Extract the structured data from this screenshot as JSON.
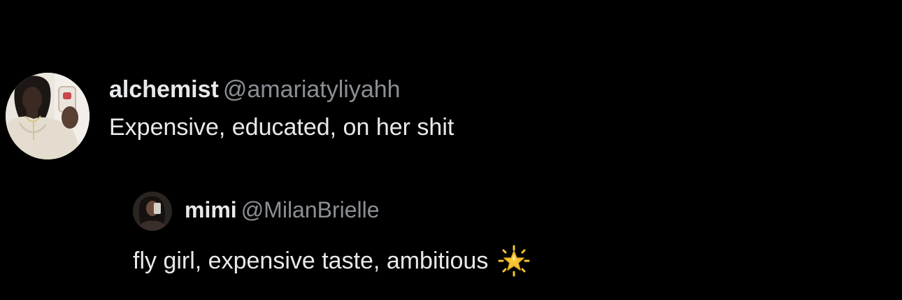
{
  "post": {
    "display_name": "alchemist",
    "handle": "@amariatyliyahh",
    "text": "Expensive, educated, on her shit"
  },
  "quoted_post": {
    "display_name": "mimi",
    "handle": "@MilanBrielle",
    "text": "fly girl, expensive taste, ambitious",
    "emoji": "glowing-star-icon"
  },
  "colors": {
    "background": "#000000",
    "primary_text": "#e7e9ea",
    "secondary_text": "#8b8f94",
    "star": "#f7c531"
  }
}
